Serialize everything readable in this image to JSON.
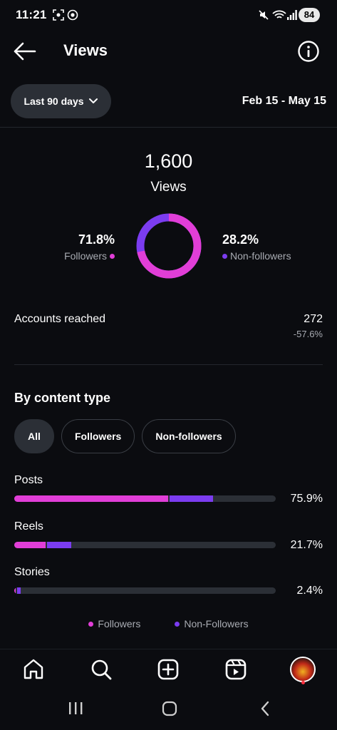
{
  "status_bar": {
    "time": "11:21",
    "battery": "84"
  },
  "header": {
    "title": "Views"
  },
  "range": {
    "button_label": "Last 90 days",
    "dates": "Feb 15 - May 15"
  },
  "summary": {
    "total": "1,600",
    "label": "Views",
    "followers_pct": "71.8%",
    "followers_label": "Followers",
    "followers_fraction": 0.718,
    "nonfollowers_pct": "28.2%",
    "nonfollowers_label": "Non-followers"
  },
  "accounts_reached": {
    "label": "Accounts reached",
    "value": "272",
    "delta": "-57.6%"
  },
  "content_type": {
    "title": "By content type",
    "chips": [
      "All",
      "Followers",
      "Non-followers"
    ],
    "active_chip": "All",
    "rows": [
      {
        "label": "Posts",
        "pct": "75.9%",
        "total": 0.759,
        "followers": 0.589
      },
      {
        "label": "Reels",
        "pct": "21.7%",
        "total": 0.217,
        "followers": 0.12
      },
      {
        "label": "Stories",
        "pct": "2.4%",
        "total": 0.024,
        "followers": 0.006
      }
    ],
    "legend": {
      "followers": "Followers",
      "nonfollowers": "Non-Followers"
    }
  },
  "colors": {
    "followers": "#e13ed7",
    "nonfollowers": "#7b3cf0",
    "background": "#0b0c10"
  },
  "icons": {
    "nav": [
      "home-icon",
      "search-icon",
      "create-icon",
      "reels-icon",
      "profile-avatar"
    ],
    "system": [
      "recents-icon",
      "home-circle-icon",
      "back-chevron-icon"
    ]
  }
}
